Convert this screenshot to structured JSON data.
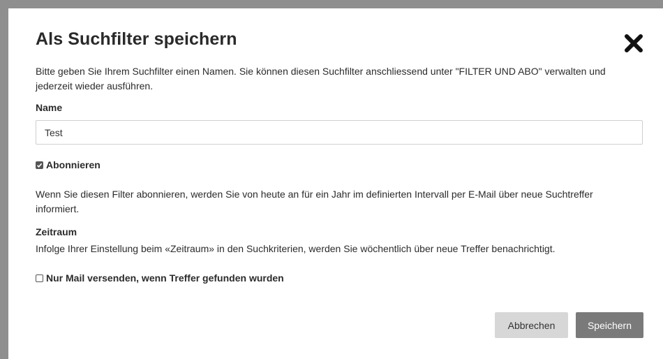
{
  "dialog": {
    "title": "Als Suchfilter speichern",
    "intro": "Bitte geben Sie Ihrem Suchfilter einen Namen. Sie können diesen Suchfilter anschliessend unter \"FILTER UND ABO\" verwalten und jederzeit wieder ausführen.",
    "name_label": "Name",
    "name_value": "Test",
    "subscribe_label": "Abonnieren",
    "subscribe_checked": true,
    "subscribe_info": "Wenn Sie diesen Filter abonnieren, werden Sie von heute an für ein Jahr im definierten Intervall per E-Mail über neue Suchtreffer informiert.",
    "zeitraum_label": "Zeitraum",
    "zeitraum_info": "Infolge Ihrer Einstellung beim «Zeitraum» in den Suchkriterien, werden Sie wöchentlich über neue Treffer benachrichtigt.",
    "mail_only_label": "Nur Mail versenden, wenn Treffer gefunden wurden",
    "mail_only_checked": false,
    "cancel_label": "Abbrechen",
    "save_label": "Speichern"
  },
  "icons": {
    "close": "close-icon",
    "check": "checkmark-icon"
  },
  "colors": {
    "save_button": "#7a7a7a",
    "cancel_button": "#d7d7d7",
    "backdrop": "#8f8f8f"
  }
}
